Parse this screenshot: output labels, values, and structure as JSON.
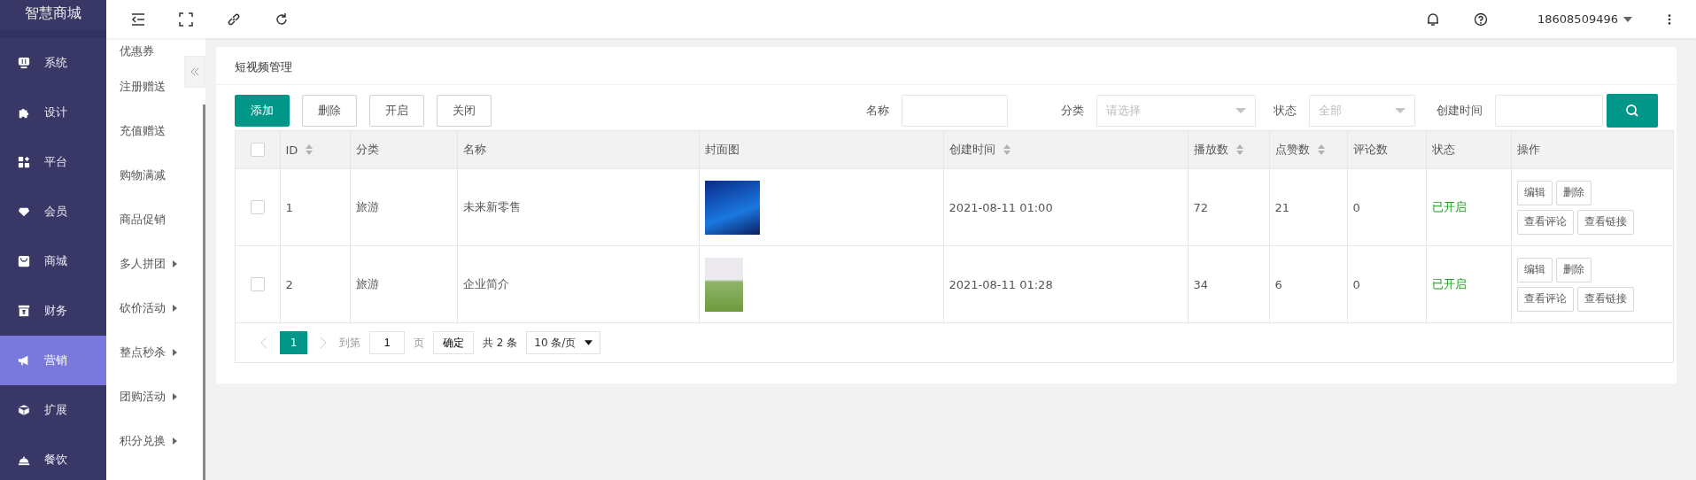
{
  "brand": "智慧商城",
  "menu": [
    {
      "label": "系统",
      "selected": false
    },
    {
      "label": "设计",
      "selected": false
    },
    {
      "label": "平台",
      "selected": false
    },
    {
      "label": "会员",
      "selected": false
    },
    {
      "label": "商城",
      "selected": false
    },
    {
      "label": "财务",
      "selected": false
    },
    {
      "label": "营销",
      "selected": true
    },
    {
      "label": "扩展",
      "selected": false
    },
    {
      "label": "餐饮",
      "selected": false
    }
  ],
  "submenu": [
    {
      "label": "优惠券",
      "has_children": false
    },
    {
      "label": "注册赠送",
      "has_children": false
    },
    {
      "label": "充值赠送",
      "has_children": false
    },
    {
      "label": "购物满减",
      "has_children": false
    },
    {
      "label": "商品促销",
      "has_children": false
    },
    {
      "label": "多人拼团",
      "has_children": true
    },
    {
      "label": "砍价活动",
      "has_children": true
    },
    {
      "label": "整点秒杀",
      "has_children": true
    },
    {
      "label": "团购活动",
      "has_children": true
    },
    {
      "label": "积分兑换",
      "has_children": true
    }
  ],
  "user": "18608509496",
  "card_title": "短视频管理",
  "actions": [
    {
      "label": "添加",
      "primary": true
    },
    {
      "label": "删除",
      "primary": false
    },
    {
      "label": "开启",
      "primary": false
    },
    {
      "label": "关闭",
      "primary": false
    }
  ],
  "filters": [
    {
      "label": "名称",
      "kind": "input"
    },
    {
      "label": "分类",
      "kind": "select",
      "placeholder": "请选择"
    },
    {
      "label": "状态",
      "kind": "select",
      "placeholder": "全部"
    },
    {
      "label": "创建时间",
      "kind": "input"
    }
  ],
  "table": {
    "all_checked": false,
    "columns": [
      {
        "label": "ID",
        "sortable": true
      },
      {
        "label": "分类",
        "sortable": false
      },
      {
        "label": "名称",
        "sortable": false
      },
      {
        "label": "封面图",
        "sortable": false
      },
      {
        "label": "创建时间",
        "sortable": true
      },
      {
        "label": "播放数",
        "sortable": true
      },
      {
        "label": "点赞数",
        "sortable": true
      },
      {
        "label": "评论数",
        "sortable": false
      },
      {
        "label": "状态",
        "sortable": false
      },
      {
        "label": "操作",
        "sortable": false
      }
    ],
    "rows": [
      {
        "checked": false,
        "id": "1",
        "category": "旅游",
        "name": "未来新零售",
        "created": "2021-08-11 01:00",
        "plays": "72",
        "likes": "21",
        "comments": "0",
        "status": "已开启",
        "enabled": true,
        "buttons": [
          "编辑",
          "删除",
          "查看评论",
          "查看链接"
        ]
      },
      {
        "checked": false,
        "id": "2",
        "category": "旅游",
        "name": "企业简介",
        "created": "2021-08-11 01:28",
        "plays": "34",
        "likes": "6",
        "comments": "0",
        "status": "已开启",
        "enabled": true,
        "buttons": [
          "编辑",
          "删除",
          "查看评论",
          "查看链接"
        ]
      }
    ]
  },
  "pagination": {
    "pages": [
      {
        "label": "1",
        "selected": true
      }
    ],
    "goto_label": "到第",
    "goto_value": "1",
    "page_unit": "页",
    "confirm": "确定",
    "total": "共 2 条",
    "page_size": "10 条/页"
  }
}
